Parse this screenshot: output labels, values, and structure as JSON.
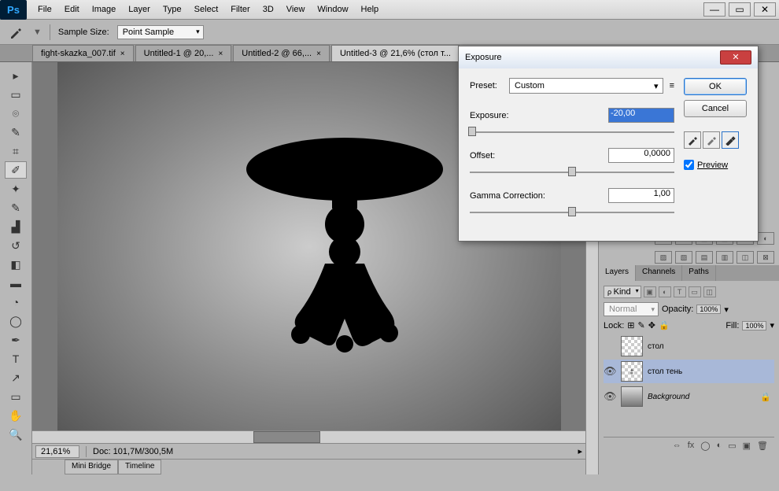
{
  "menubar": {
    "items": [
      "File",
      "Edit",
      "Image",
      "Layer",
      "Type",
      "Select",
      "Filter",
      "3D",
      "View",
      "Window",
      "Help"
    ]
  },
  "option_bar": {
    "sample_label": "Sample Size:",
    "sample_value": "Point Sample"
  },
  "tabs": [
    {
      "label": "fight-skazka_007.tif"
    },
    {
      "label": "Untitled-1 @ 20,..."
    },
    {
      "label": "Untitled-2 @ 66,..."
    },
    {
      "label": "Untitled-3 @ 21,6% (стол т..."
    }
  ],
  "status": {
    "zoom": "21,61%",
    "doc": "Doc: 101,7M/300,5M"
  },
  "bottom_tabs": [
    "Mini Bridge",
    "Timeline"
  ],
  "panels": {
    "tabs": [
      "Layers",
      "Channels",
      "Paths"
    ],
    "kind_label": "Kind",
    "blend_mode": "Normal",
    "opacity_label": "Opacity:",
    "opacity_value": "100%",
    "lock_label": "Lock:",
    "fill_label": "Fill:",
    "fill_value": "100%",
    "layers": [
      {
        "name": "стол",
        "visible": false,
        "selected": false
      },
      {
        "name": "стол тень",
        "visible": true,
        "selected": true
      },
      {
        "name": "Background",
        "visible": true,
        "selected": false,
        "locked": true,
        "italic": true
      }
    ]
  },
  "dialog": {
    "title": "Exposure",
    "preset_label": "Preset:",
    "preset_value": "Custom",
    "exposure_label": "Exposure:",
    "exposure_value": "-20,00",
    "offset_label": "Offset:",
    "offset_value": "0,0000",
    "gamma_label": "Gamma Correction:",
    "gamma_value": "1,00",
    "ok": "OK",
    "cancel": "Cancel",
    "preview": "Preview"
  }
}
